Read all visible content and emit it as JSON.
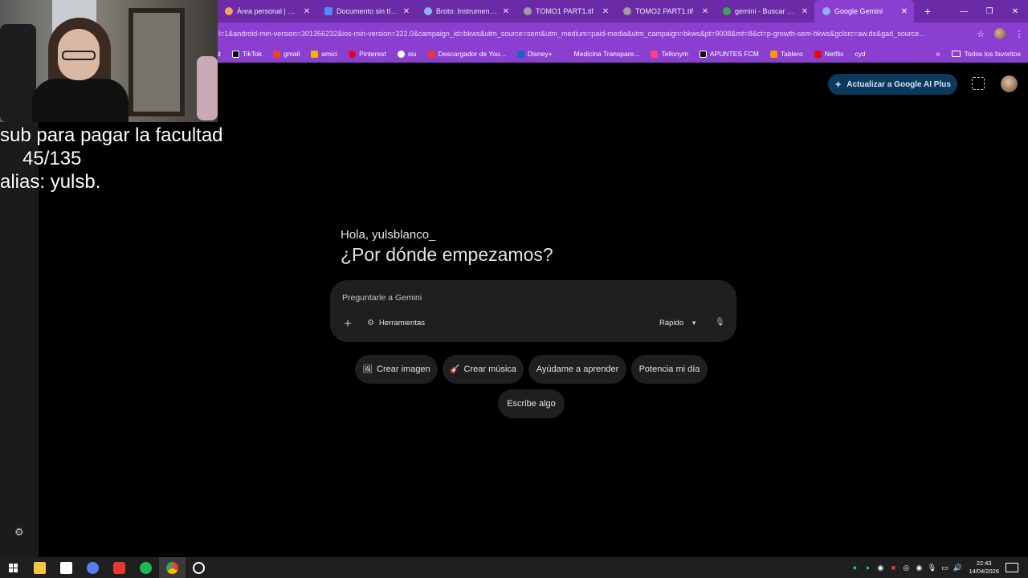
{
  "browser": {
    "tabs": [
      {
        "label": "Área personal | Camp",
        "color": "#f6a45c"
      },
      {
        "label": "Documento sin título",
        "color": "#4f8cf5"
      },
      {
        "label": "Broto: Instrumentació",
        "color": "#8ab4f8"
      },
      {
        "label": "TOMO1 PART1.tif",
        "color": "#9e9e9e"
      },
      {
        "label": "TOMO2 PART1.tif",
        "color": "#9e9e9e"
      },
      {
        "label": "gemini - Buscar con G",
        "color": "#34a853"
      },
      {
        "label": "Google Gemini",
        "color": "#8ab4f8"
      }
    ],
    "new_tab": "+",
    "tab_close": "✕",
    "url": "l=1&android-min-version=301356232&ios-min-version=322.0&campaign_id=bkws&utm_source=sem&utm_medium=paid-media&utm_campaign=bkws&pt=9008&mt=8&ct=p-growth-sem-bkws&gclsrc=aw.ds&gad_source...",
    "bookmarks": [
      {
        "label": "d",
        "color": "#8a3fd0"
      },
      {
        "label": "TikTok",
        "color": "#000000"
      },
      {
        "label": "gmail",
        "color": "#ea4335"
      },
      {
        "label": "amici",
        "color": "#f4b400"
      },
      {
        "label": "Pinterest",
        "color": "#e60023"
      },
      {
        "label": "siu",
        "color": "#ffffff"
      },
      {
        "label": "Descargador de You...",
        "color": "#e53935"
      },
      {
        "label": "Disney+",
        "color": "#1565c0"
      },
      {
        "label": "Medicina Transpare...",
        "color": "#8a3fd0"
      },
      {
        "label": "Tellonym",
        "color": "#ff4081"
      },
      {
        "label": "APUNTES FCM",
        "color": "#111111"
      },
      {
        "label": "Tablero",
        "color": "#ff9800"
      },
      {
        "label": "Netflix",
        "color": "#e50914"
      },
      {
        "label": "cyd",
        "color": "#8a3fd0"
      }
    ],
    "bookmarks_more": "»",
    "all_favorites": "Todos los favoritos"
  },
  "stream_overlay": {
    "line1": "sub para pagar la facultad",
    "line2": "45/135",
    "line3": "alias: yulsb."
  },
  "gemini": {
    "upgrade_label": "Actualizar a Google AI Plus",
    "greeting": "Hola, yulsblanco_",
    "headline": "¿Por dónde empezamos?",
    "prompt_placeholder": "Preguntarle a Gemini",
    "tools_label": "Herramientas",
    "mode_label": "Rápido",
    "chips": {
      "create_image": "Crear imagen",
      "create_music": "Crear música",
      "help_learn": "Ayúdame a aprender",
      "boost_day": "Potencia mi día",
      "write": "Escribe algo"
    },
    "accent": "#0b3a5c"
  },
  "taskbar": {
    "time": "22:43",
    "date": "14/04/2026"
  }
}
